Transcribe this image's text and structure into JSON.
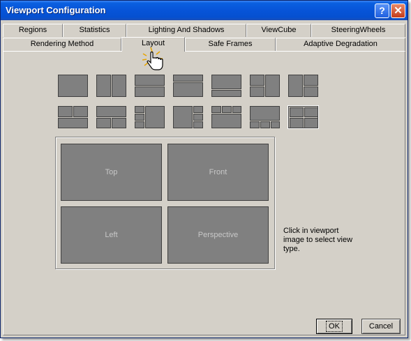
{
  "window": {
    "title": "Viewport Configuration",
    "help_label": "?",
    "close_label": "✕"
  },
  "tabs_row1": [
    "Regions",
    "Statistics",
    "Lighting And Shadows",
    "ViewCube",
    "SteeringWheels"
  ],
  "tabs_row2": [
    "Rendering Method",
    "Layout",
    "Safe Frames",
    "Adaptive Degradation"
  ],
  "active_tab": "Layout",
  "layouts": {
    "row1": [
      "single",
      "two-vertical",
      "two-horizontal",
      "top-thin-bottom-large",
      "top-large-bottom-thin",
      "three-left-split",
      "three-right-split"
    ],
    "row2": [
      "three-top-split",
      "three-bottom-split",
      "three-left-stack",
      "three-right-stack",
      "four-top-split",
      "four-bottom-split",
      "four-quad"
    ],
    "selected": "four-quad"
  },
  "viewports": [
    "Top",
    "Front",
    "Left",
    "Perspective"
  ],
  "hint_text": "Click in viewport image to select view type.",
  "buttons": {
    "ok": "OK",
    "cancel": "Cancel"
  }
}
